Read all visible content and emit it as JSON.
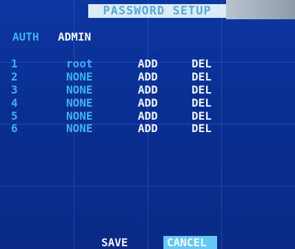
{
  "title": "PASSWORD SETUP",
  "auth": {
    "label": "AUTH",
    "value": "ADMIN"
  },
  "users": [
    {
      "index": "1",
      "name": "root",
      "add": "ADD",
      "del": "DEL"
    },
    {
      "index": "2",
      "name": "NONE",
      "add": "ADD",
      "del": "DEL"
    },
    {
      "index": "3",
      "name": "NONE",
      "add": "ADD",
      "del": "DEL"
    },
    {
      "index": "4",
      "name": "NONE",
      "add": "ADD",
      "del": "DEL"
    },
    {
      "index": "5",
      "name": "NONE",
      "add": "ADD",
      "del": "DEL"
    },
    {
      "index": "6",
      "name": "NONE",
      "add": "ADD",
      "del": "DEL"
    }
  ],
  "footer": {
    "save_label": "SAVE",
    "cancel_label": "CANCEL"
  },
  "colors": {
    "background": "#0b2f8e",
    "accent_cyan": "#3fb3f0",
    "highlight": "#63c8f5",
    "text_white": "#f2f6ff"
  }
}
